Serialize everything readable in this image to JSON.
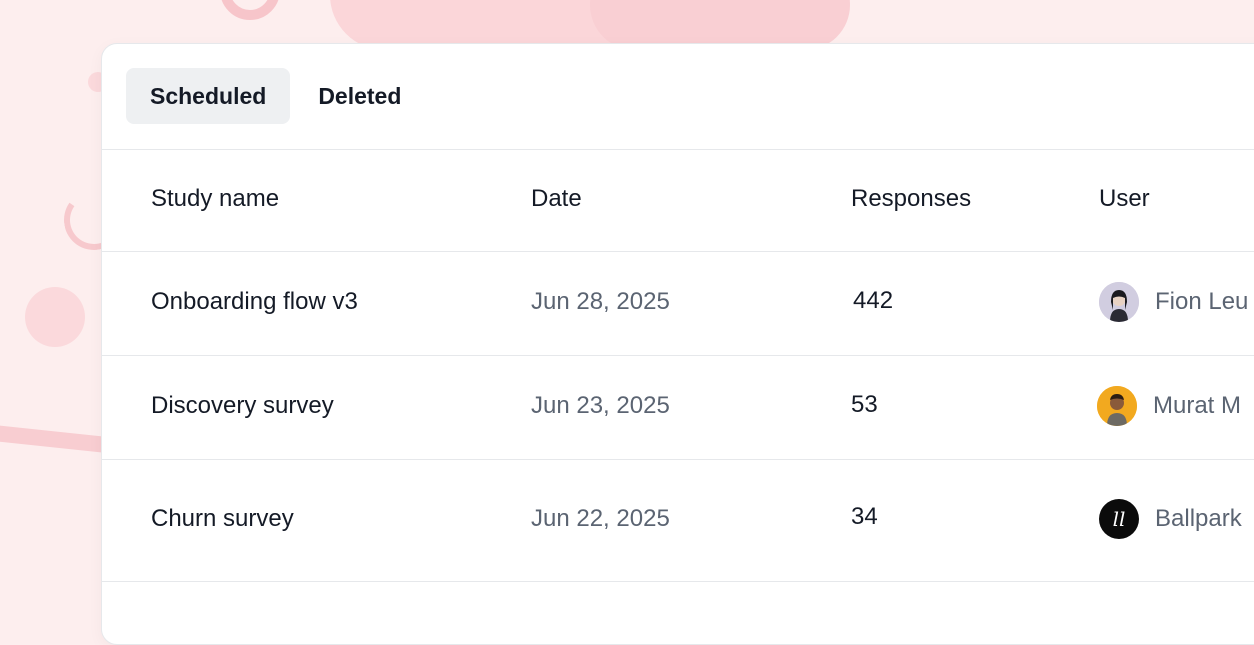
{
  "tabs": [
    {
      "label": "Scheduled",
      "active": true
    },
    {
      "label": "Deleted",
      "active": false
    }
  ],
  "table": {
    "columns": [
      "Study name",
      "Date",
      "Responses",
      "User"
    ],
    "rows": [
      {
        "name": "Onboarding flow v3",
        "date": "Jun 28, 2025",
        "responses": "442",
        "user": "Fion Leu",
        "avatar": "person-photo-icon"
      },
      {
        "name": "Discovery survey",
        "date": "Jun 23, 2025",
        "responses": "53",
        "user": "Murat M",
        "avatar": "person-photo-icon"
      },
      {
        "name": "Churn survey",
        "date": "Jun 22, 2025",
        "responses": "34",
        "user": "Ballpark",
        "avatar": "ballpark-logo-icon",
        "avatar_text": "ll"
      }
    ]
  },
  "colors": {
    "background": "#fdeeee",
    "card": "#ffffff",
    "text_primary": "#141a26",
    "text_secondary": "#5b6472",
    "tab_active_bg": "#eef0f2"
  }
}
